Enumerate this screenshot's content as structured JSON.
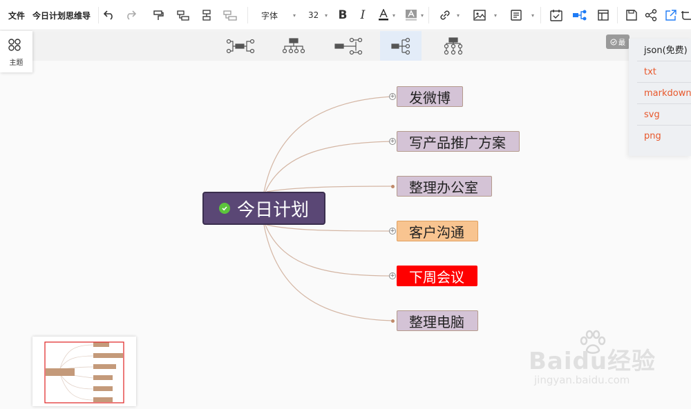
{
  "toolbar": {
    "file": "文件",
    "doc_title": "今日计划思维导",
    "font_label": "字体",
    "font_size": "32",
    "icons": [
      "undo-icon",
      "redo-icon",
      "format-painter-icon",
      "insert-child-icon",
      "insert-sibling-icon",
      "insert-parent-icon",
      "bold-icon",
      "italic-icon",
      "font-color-icon",
      "highlight-icon",
      "link-icon",
      "image-icon",
      "note-icon",
      "task-icon",
      "structure-icon",
      "layout-icon",
      "save-icon",
      "share-icon",
      "export-icon",
      "crop-icon"
    ],
    "accent": "#1e7bf5"
  },
  "theme": {
    "label": "主题"
  },
  "layout_bar": {
    "layouts": [
      "mind-map-layout",
      "org-chart-down-layout",
      "logic-right-layout",
      "mind-map-right-layout",
      "tree-down-layout"
    ],
    "active": "mind-map-right-layout",
    "badge": "最"
  },
  "export_menu": {
    "items": [
      "json(免费)",
      "txt",
      "markdown",
      "svg",
      "png"
    ],
    "item_color": "#e8572b"
  },
  "mindmap": {
    "root": {
      "text": "今日计划",
      "color": "#5a4775",
      "checked": true
    },
    "children": [
      {
        "text": "发微博",
        "bg": "#d4c3d6",
        "expand": true
      },
      {
        "text": "写产品推广方案",
        "bg": "#d4c3d6",
        "expand": true
      },
      {
        "text": "整理办公室",
        "bg": "#d4c3d6",
        "expand": false
      },
      {
        "text": "客户沟通",
        "bg": "#f8c490",
        "expand": true
      },
      {
        "text": "下周会议",
        "bg": "#ff0000",
        "text_color": "#ffffff",
        "expand": true
      },
      {
        "text": "整理电脑",
        "bg": "#d4c3d6",
        "expand": false
      }
    ],
    "line_color": "#d4b6a4"
  },
  "watermark": {
    "brand": "Baidu经验",
    "url": "jingyan.baidu.com"
  }
}
